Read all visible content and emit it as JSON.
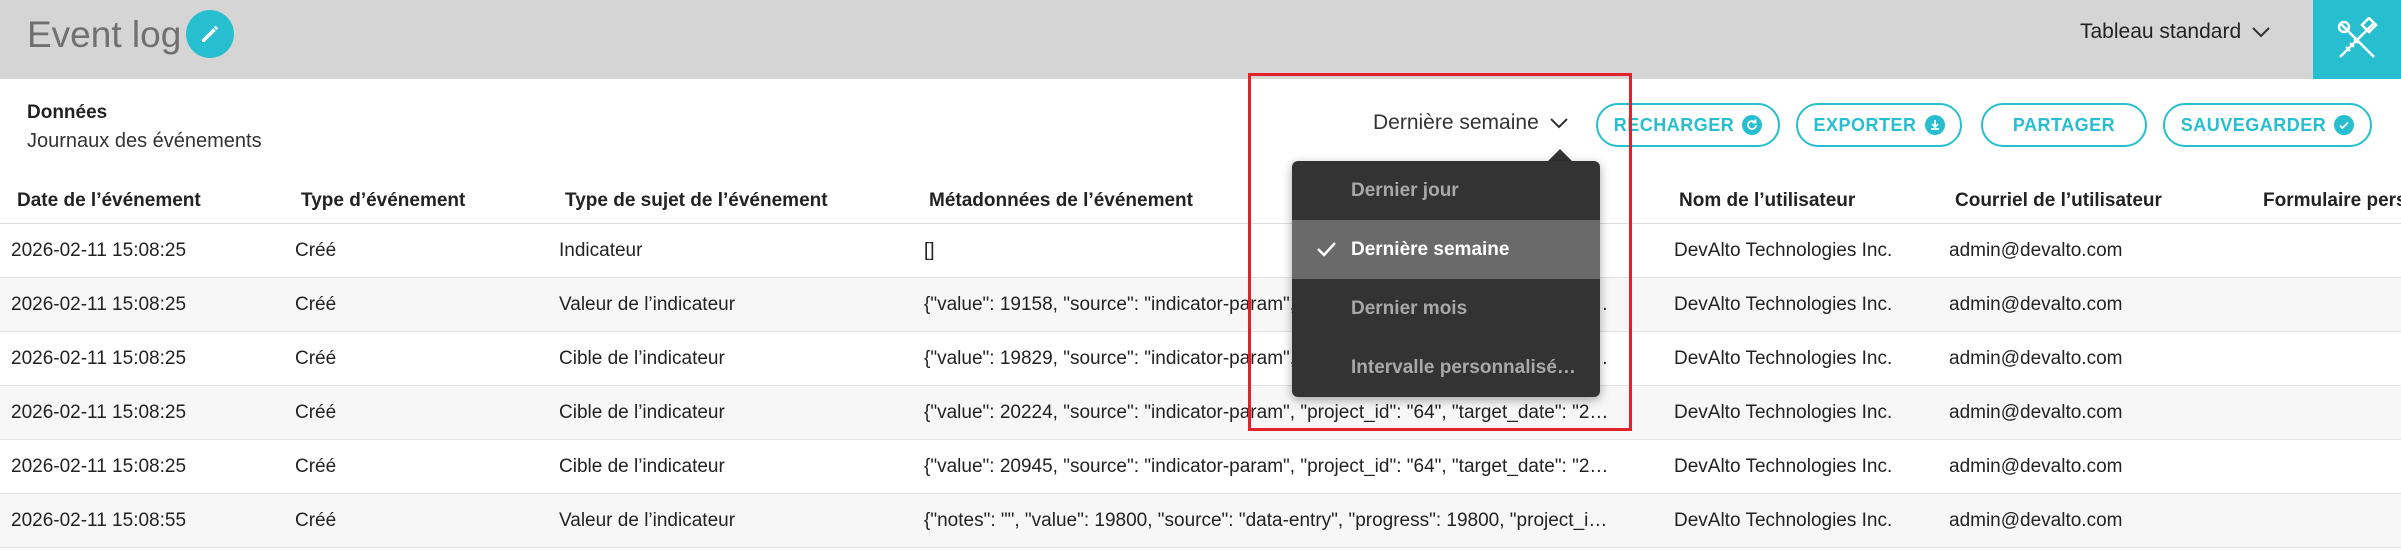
{
  "header": {
    "title": "Event log",
    "view_selector": "Tableau standard"
  },
  "source": {
    "heading": "Données",
    "name": "Journaux des événements"
  },
  "toolbar": {
    "period": "Dernière semaine",
    "reload": "RECHARGER",
    "export": "EXPORTER",
    "share": "PARTAGER",
    "save": "SAUVEGARDER"
  },
  "menu": {
    "items": [
      {
        "label": "Dernier jour",
        "selected": false
      },
      {
        "label": "Dernière semaine",
        "selected": true
      },
      {
        "label": "Dernier mois",
        "selected": false
      },
      {
        "label": "Intervalle personnalisé…",
        "selected": false
      }
    ]
  },
  "table": {
    "columns": [
      "Date de l’événement",
      "Type d’événement",
      "Type de sujet de l’événement",
      "Métadonnées de l’événement",
      "Nom de l’utilisateur",
      "Courriel de l’utilisateur",
      "Formulaire pers"
    ],
    "rows": [
      {
        "date": "2026-02-11 15:08:25",
        "type": "Créé",
        "subject": "Indicateur",
        "meta": "[]",
        "user": "DevAlto Technologies Inc.",
        "email": "admin@devalto.com"
      },
      {
        "date": "2026-02-11 15:08:25",
        "type": "Créé",
        "subject": "Valeur de l’indicateur",
        "meta": "{\"value\": 19158, \"source\": \"indicator-param\", \"project_id\": \"64\", \"target_date\": \"2…",
        "user": "DevAlto Technologies Inc.",
        "email": "admin@devalto.com"
      },
      {
        "date": "2026-02-11 15:08:25",
        "type": "Créé",
        "subject": "Cible de l’indicateur",
        "meta": "{\"value\": 19829, \"source\": \"indicator-param\", \"project_id\": \"64\", \"target_date\": \"2…",
        "user": "DevAlto Technologies Inc.",
        "email": "admin@devalto.com"
      },
      {
        "date": "2026-02-11 15:08:25",
        "type": "Créé",
        "subject": "Cible de l’indicateur",
        "meta": "{\"value\": 20224, \"source\": \"indicator-param\", \"project_id\": \"64\", \"target_date\": \"2…",
        "user": "DevAlto Technologies Inc.",
        "email": "admin@devalto.com"
      },
      {
        "date": "2026-02-11 15:08:25",
        "type": "Créé",
        "subject": "Cible de l’indicateur",
        "meta": "{\"value\": 20945, \"source\": \"indicator-param\", \"project_id\": \"64\", \"target_date\": \"2…",
        "user": "DevAlto Technologies Inc.",
        "email": "admin@devalto.com"
      },
      {
        "date": "2026-02-11 15:08:55",
        "type": "Créé",
        "subject": "Valeur de l’indicateur",
        "meta": "{\"notes\": \"\", \"value\": 19800, \"source\": \"data-entry\", \"progress\": 19800, \"project_i…",
        "user": "DevAlto Technologies Inc.",
        "email": "admin@devalto.com"
      }
    ]
  },
  "colors": {
    "accent": "#27bfcf",
    "header_bg": "#d5d5d5",
    "menu_bg": "#333333",
    "menu_selected_bg": "#6a6a6a",
    "highlight": "#e0202a"
  },
  "icons": [
    "pencil-icon",
    "chevron-down-icon",
    "tools-icon",
    "refresh-icon",
    "download-icon",
    "check-circle-icon",
    "check-icon"
  ]
}
